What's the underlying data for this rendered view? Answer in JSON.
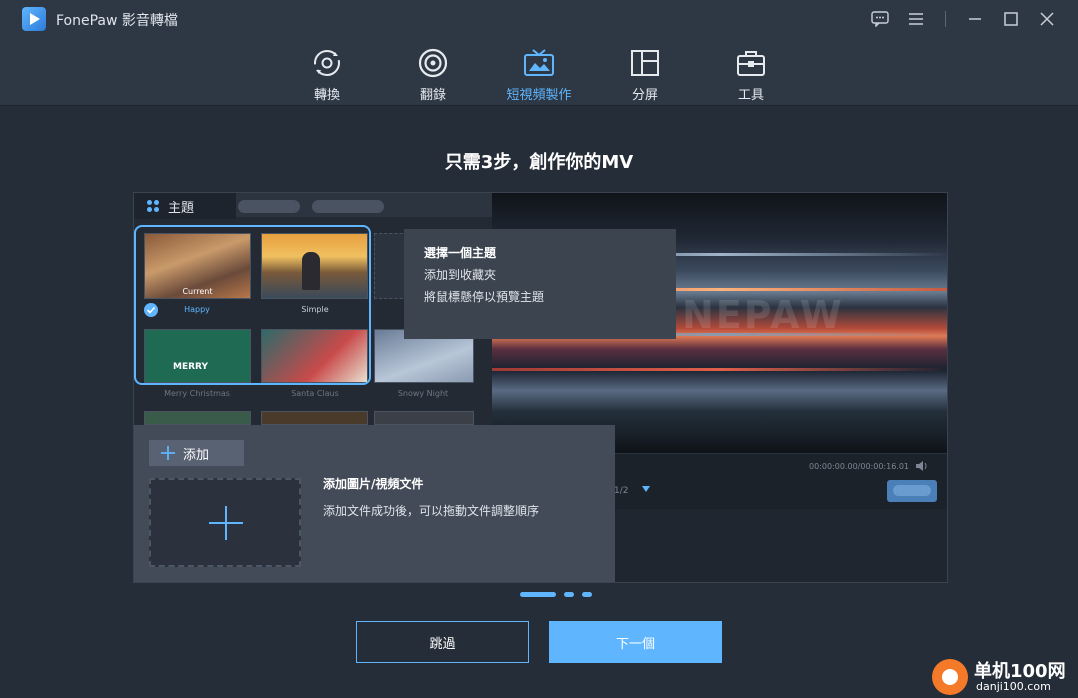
{
  "app": {
    "title": "FonePaw 影音轉檔"
  },
  "titlebar": {
    "icons": [
      "feedback-icon",
      "menu-icon",
      "minimize-icon",
      "maximize-icon",
      "close-icon"
    ]
  },
  "nav": {
    "items": [
      {
        "label": "轉換",
        "icon": "convert-icon"
      },
      {
        "label": "翻錄",
        "icon": "rip-icon"
      },
      {
        "label": "短視頻製作",
        "icon": "mv-icon",
        "active": true
      },
      {
        "label": "分屏",
        "icon": "collage-icon"
      },
      {
        "label": "工具",
        "icon": "toolbox-icon"
      }
    ]
  },
  "main": {
    "heading": "只需3步，創作你的MV"
  },
  "preview": {
    "theme_tab": "主題",
    "themes": [
      {
        "name": "Happy",
        "badge": "Current",
        "selected": true
      },
      {
        "name": "Simple"
      },
      {
        "name": "Merry Christmas"
      },
      {
        "name": "Santa Claus"
      },
      {
        "name": "Snowy Night"
      }
    ],
    "merry_text": "MERRY",
    "tooltip": {
      "title": "選擇一個主題",
      "line1": "添加到收藏夾",
      "line2": "將鼠標懸停以預覽主題"
    },
    "watermark": "NEPAW",
    "timecode": "00:00:00.00/00:00:16.01",
    "page": "1/2"
  },
  "add_panel": {
    "button_label": "添加",
    "title": "添加圖片/視頻文件",
    "desc": "添加文件成功後，可以拖動文件調整順序"
  },
  "pager": {
    "current": 1,
    "total": 3
  },
  "buttons": {
    "skip": "跳過",
    "next": "下一個"
  },
  "brand": {
    "name": "单机100网",
    "url": "danji100.com"
  },
  "colors": {
    "accent": "#5fb6ff",
    "background": "#252d38"
  }
}
